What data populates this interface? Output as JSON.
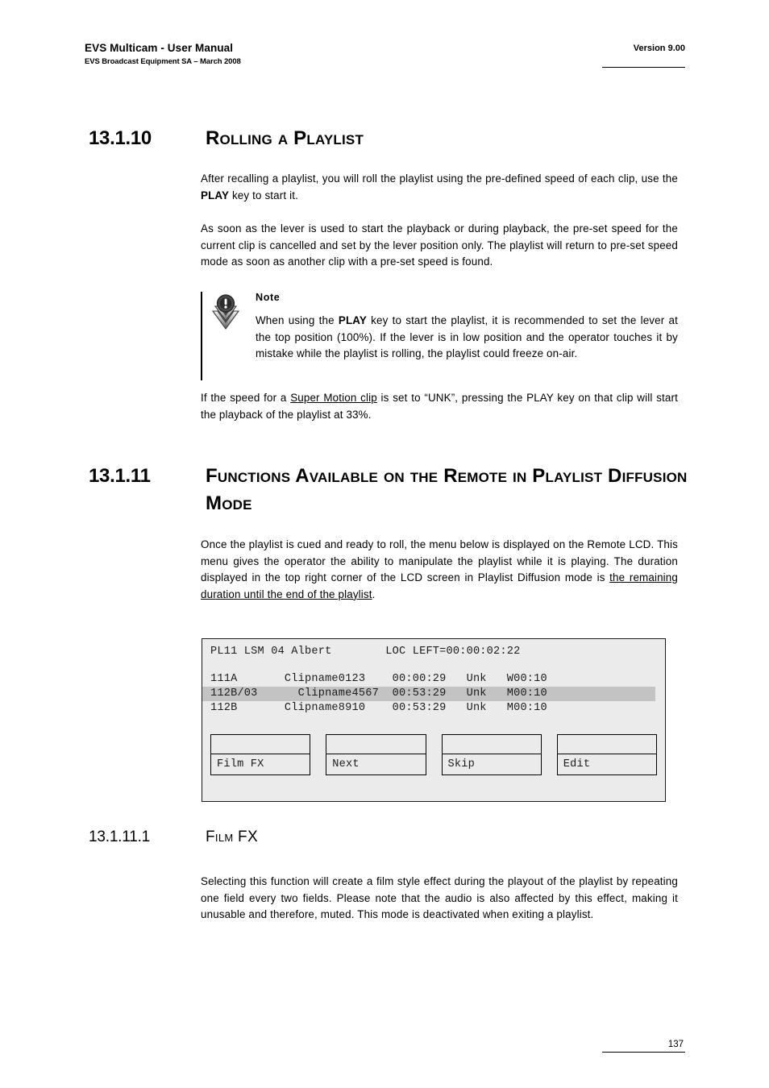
{
  "header": {
    "title": "EVS Multicam - User Manual",
    "subtitle": "EVS Broadcast Equipment SA – March 2008",
    "version": "Version 9.00"
  },
  "sections": {
    "rolling": {
      "number": "13.1.10",
      "title": "Rolling a Playlist",
      "para1_a": "After recalling a playlist, you will roll the playlist using the pre-defined speed of each clip, use the ",
      "para1_b": "PLAY",
      "para1_c": " key to start it.",
      "para2": "As soon as the lever is used to start the playback or during playback, the pre-set speed for the current clip is cancelled and set by the lever position only. The playlist will return to pre-set speed mode as soon as another clip with a pre-set speed is found.",
      "para3_a": "If the speed for a ",
      "para3_link": "Super Motion clip",
      "para3_b": " is set to “UNK”, pressing the PLAY key on that clip will start the playback of the playlist at 33%."
    },
    "note": {
      "icon": "note-exclamation-icon",
      "title": "Note",
      "body_a": "When using the ",
      "body_b": "PLAY",
      "body_c": " key to start the playlist, it is recommended to set the lever at the top position (100%). If the lever is in low position and the operator touches it by mistake while the playlist is rolling, the playlist could freeze on-air."
    },
    "functions": {
      "number": "13.1.11",
      "title": "Functions Available on the Remote in Playlist Diffusion Mode",
      "para_a": "Once the playlist is cued and ready to roll, the menu below is displayed on the Remote LCD. This menu gives the operator the ability to manipulate the playlist while it is playing. The duration displayed in the top right corner of the LCD screen in Playlist Diffusion mode is ",
      "para_link": "the remaining duration until the end of the playlist",
      "para_b": "."
    },
    "filmfx": {
      "number": "13.1.11.1",
      "title": "Film FX",
      "para": "Selecting this function will create a film style effect during the playout of the playlist by repeating one field every two fields. Please note that the audio is also affected by this effect, making it unusable and therefore, muted. This mode is deactivated when exiting a playlist."
    }
  },
  "lcd": {
    "title_line": "PL11 LSM 04 Albert        LOC LEFT=00:00:02:22",
    "rows": [
      {
        "text": "111A       Clipname0123    00:00:29   Unk   W00:10",
        "selected": false
      },
      {
        "text": "112B/03      Clipname4567  00:53:29   Unk   M00:10",
        "selected": true
      },
      {
        "text": "112B       Clipname8910    00:53:29   Unk   M00:10",
        "selected": false
      }
    ],
    "buttons": [
      {
        "label": "Film FX"
      },
      {
        "label": "Next"
      },
      {
        "label": "Skip"
      },
      {
        "label": "Edit"
      }
    ],
    "colors": {
      "screen_bg": "#ebebeb",
      "selected_row_bg": "#c3c3c3",
      "border": "#1a1a1a"
    }
  },
  "footer": {
    "page_number": "137"
  }
}
